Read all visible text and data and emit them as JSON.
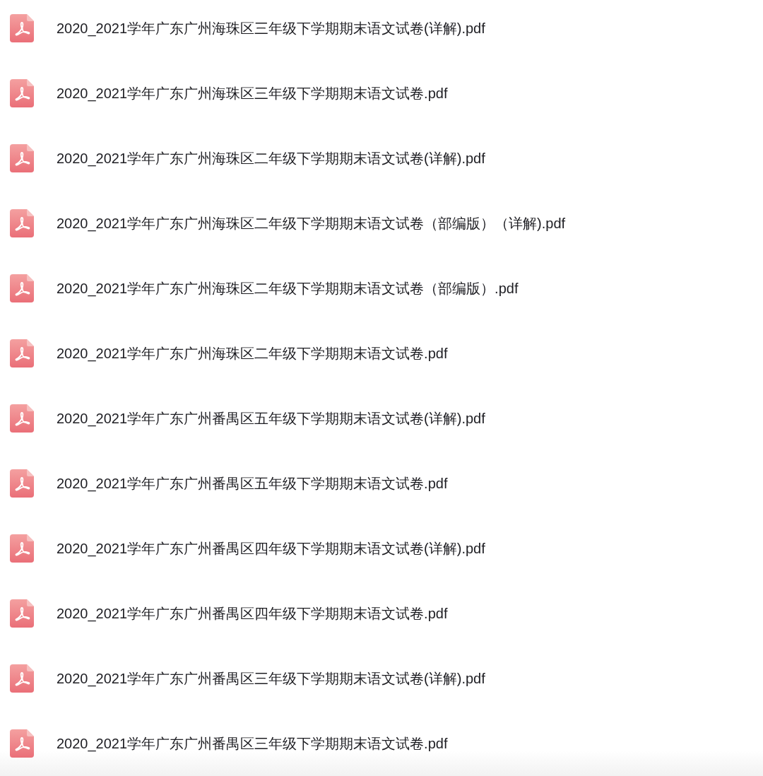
{
  "files": [
    {
      "name": "2020_2021学年广东广州海珠区三年级下学期期末语文试卷(详解).pdf"
    },
    {
      "name": "2020_2021学年广东广州海珠区三年级下学期期末语文试卷.pdf"
    },
    {
      "name": "2020_2021学年广东广州海珠区二年级下学期期末语文试卷(详解).pdf"
    },
    {
      "name": "2020_2021学年广东广州海珠区二年级下学期期末语文试卷（部编版）（详解).pdf"
    },
    {
      "name": "2020_2021学年广东广州海珠区二年级下学期期末语文试卷（部编版）.pdf"
    },
    {
      "name": "2020_2021学年广东广州海珠区二年级下学期期末语文试卷.pdf"
    },
    {
      "name": "2020_2021学年广东广州番禺区五年级下学期期末语文试卷(详解).pdf"
    },
    {
      "name": "2020_2021学年广东广州番禺区五年级下学期期末语文试卷.pdf"
    },
    {
      "name": "2020_2021学年广东广州番禺区四年级下学期期末语文试卷(详解).pdf"
    },
    {
      "name": "2020_2021学年广东广州番禺区四年级下学期期末语文试卷.pdf"
    },
    {
      "name": "2020_2021学年广东广州番禺区三年级下学期期末语文试卷(详解).pdf"
    },
    {
      "name": "2020_2021学年广东广州番禺区三年级下学期期末语文试卷.pdf"
    }
  ]
}
